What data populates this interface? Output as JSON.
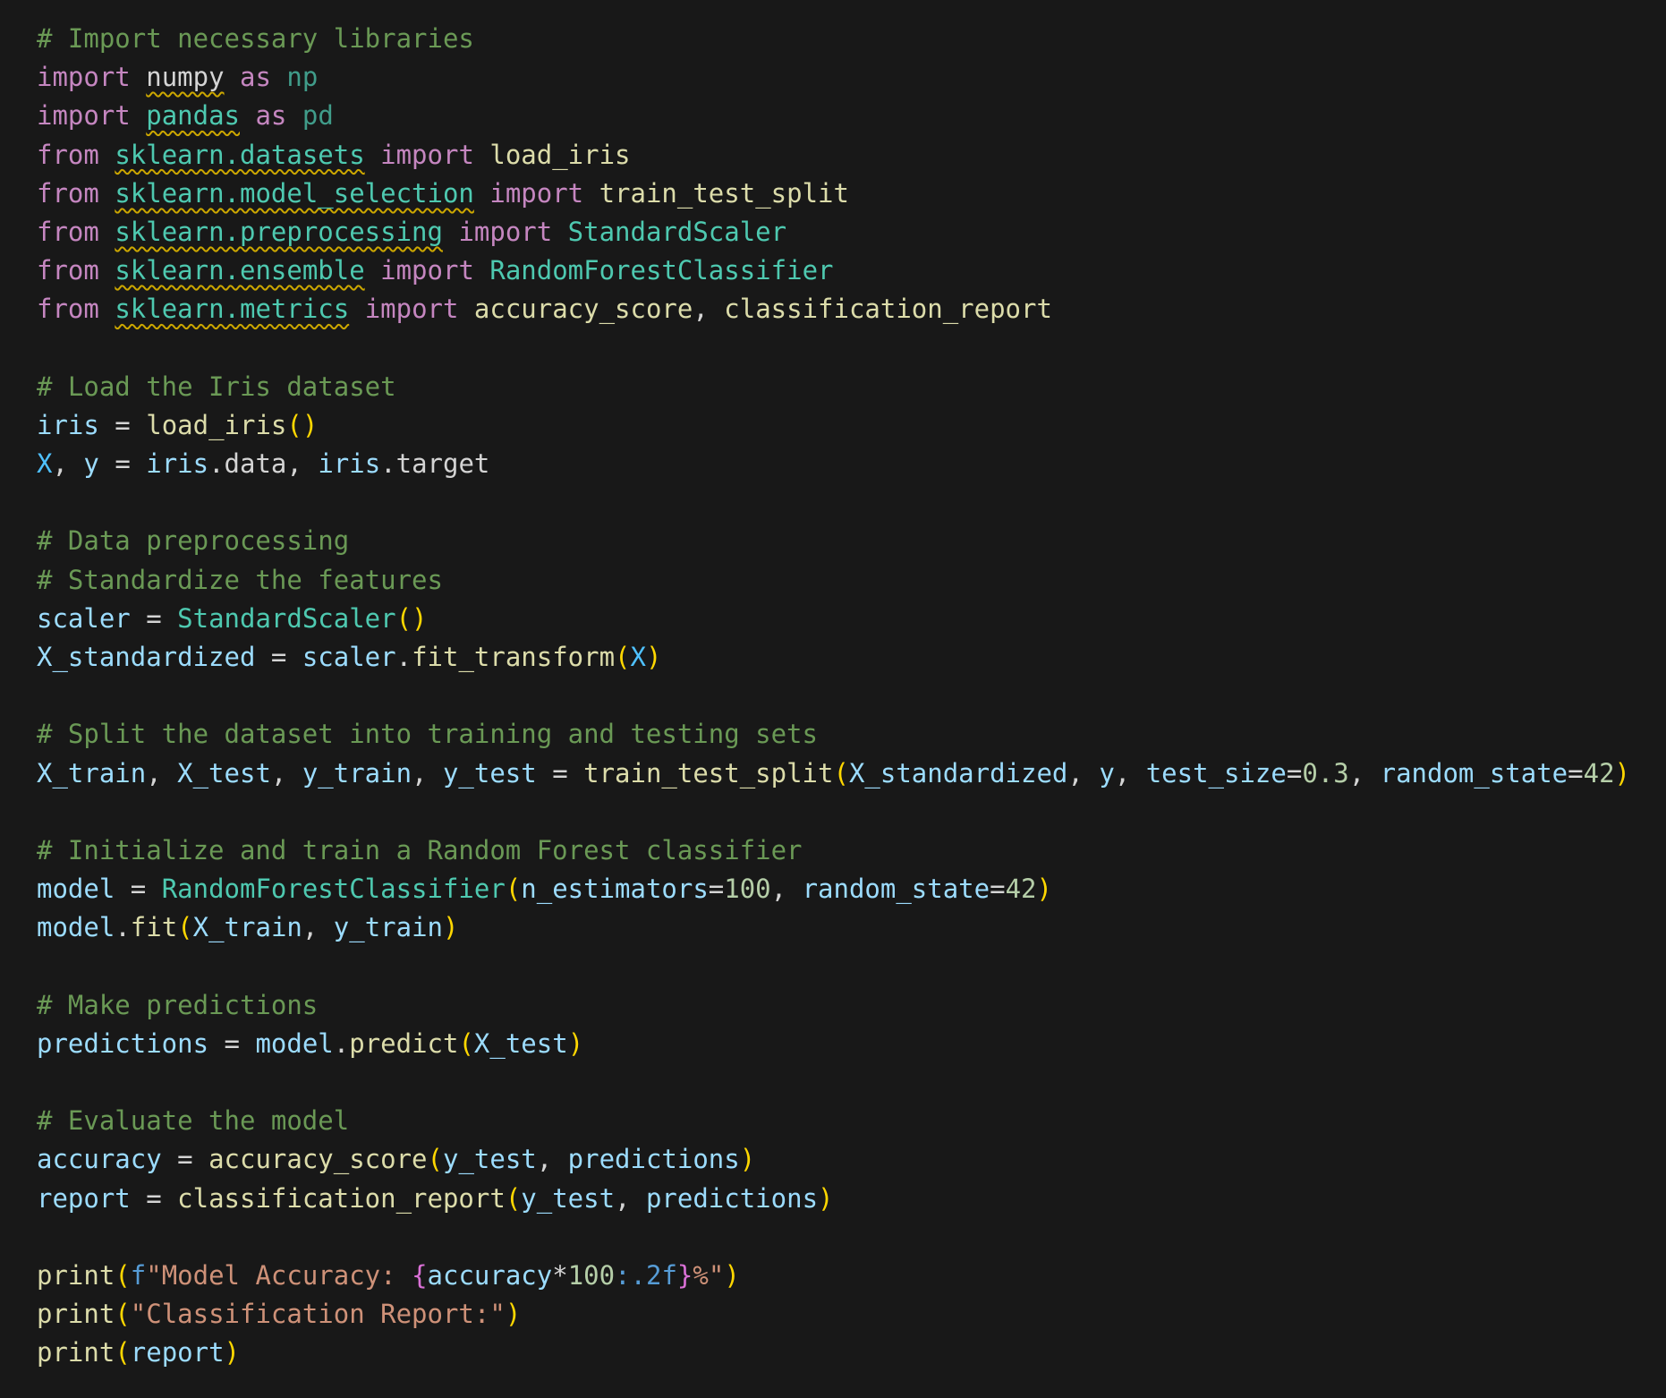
{
  "editor": {
    "colors": {
      "background": "#181818",
      "comment": "#6a9955",
      "keyword": "#c586c0",
      "class": "#4ec9b0",
      "function": "#dcdcaa",
      "variable": "#9cdcfe",
      "constant": "#4fc1ff",
      "number": "#b5cea8",
      "string": "#ce9178",
      "bracket": "#ffd700",
      "warning_squiggle": "#cca700"
    },
    "lines": [
      [
        {
          "t": "comment",
          "v": "# Import necessary libraries"
        }
      ],
      [
        {
          "t": "keyword",
          "v": "import"
        },
        {
          "t": "plain",
          "v": " "
        },
        {
          "t": "module",
          "v": "numpy",
          "sq": true
        },
        {
          "t": "plain",
          "v": " "
        },
        {
          "t": "keyword",
          "v": "as"
        },
        {
          "t": "plain",
          "v": " "
        },
        {
          "t": "alias",
          "v": "np"
        }
      ],
      [
        {
          "t": "keyword",
          "v": "import"
        },
        {
          "t": "plain",
          "v": " "
        },
        {
          "t": "module2",
          "v": "pandas",
          "sq": true
        },
        {
          "t": "plain",
          "v": " "
        },
        {
          "t": "keyword",
          "v": "as"
        },
        {
          "t": "plain",
          "v": " "
        },
        {
          "t": "alias",
          "v": "pd"
        }
      ],
      [
        {
          "t": "keyword",
          "v": "from"
        },
        {
          "t": "plain",
          "v": " "
        },
        {
          "t": "module2",
          "v": "sklearn.datasets",
          "sq": true
        },
        {
          "t": "plain",
          "v": " "
        },
        {
          "t": "keyword",
          "v": "import"
        },
        {
          "t": "plain",
          "v": " "
        },
        {
          "t": "func",
          "v": "load_iris"
        }
      ],
      [
        {
          "t": "keyword",
          "v": "from"
        },
        {
          "t": "plain",
          "v": " "
        },
        {
          "t": "module2",
          "v": "sklearn.model_selection",
          "sq": true
        },
        {
          "t": "plain",
          "v": " "
        },
        {
          "t": "keyword",
          "v": "import"
        },
        {
          "t": "plain",
          "v": " "
        },
        {
          "t": "func",
          "v": "train_test_split"
        }
      ],
      [
        {
          "t": "keyword",
          "v": "from"
        },
        {
          "t": "plain",
          "v": " "
        },
        {
          "t": "module2",
          "v": "sklearn.preprocessing",
          "sq": true
        },
        {
          "t": "plain",
          "v": " "
        },
        {
          "t": "keyword",
          "v": "import"
        },
        {
          "t": "plain",
          "v": " "
        },
        {
          "t": "class",
          "v": "StandardScaler"
        }
      ],
      [
        {
          "t": "keyword",
          "v": "from"
        },
        {
          "t": "plain",
          "v": " "
        },
        {
          "t": "module2",
          "v": "sklearn.ensemble",
          "sq": true
        },
        {
          "t": "plain",
          "v": " "
        },
        {
          "t": "keyword",
          "v": "import"
        },
        {
          "t": "plain",
          "v": " "
        },
        {
          "t": "class",
          "v": "RandomForestClassifier"
        }
      ],
      [
        {
          "t": "keyword",
          "v": "from"
        },
        {
          "t": "plain",
          "v": " "
        },
        {
          "t": "module2",
          "v": "sklearn.metrics",
          "sq": true
        },
        {
          "t": "plain",
          "v": " "
        },
        {
          "t": "keyword",
          "v": "import"
        },
        {
          "t": "plain",
          "v": " "
        },
        {
          "t": "func",
          "v": "accuracy_score"
        },
        {
          "t": "plain",
          "v": ", "
        },
        {
          "t": "func",
          "v": "classification_report"
        }
      ],
      [],
      [
        {
          "t": "comment",
          "v": "# Load the Iris dataset"
        }
      ],
      [
        {
          "t": "var",
          "v": "iris"
        },
        {
          "t": "op",
          "v": " = "
        },
        {
          "t": "func",
          "v": "load_iris"
        },
        {
          "t": "paren",
          "v": "()"
        }
      ],
      [
        {
          "t": "const",
          "v": "X"
        },
        {
          "t": "plain",
          "v": ", "
        },
        {
          "t": "var",
          "v": "y"
        },
        {
          "t": "op",
          "v": " = "
        },
        {
          "t": "var",
          "v": "iris"
        },
        {
          "t": "plain",
          "v": ".data, "
        },
        {
          "t": "var",
          "v": "iris"
        },
        {
          "t": "plain",
          "v": ".target"
        }
      ],
      [],
      [
        {
          "t": "comment",
          "v": "# Data preprocessing"
        }
      ],
      [
        {
          "t": "comment",
          "v": "# Standardize the features"
        }
      ],
      [
        {
          "t": "var",
          "v": "scaler"
        },
        {
          "t": "op",
          "v": " = "
        },
        {
          "t": "class",
          "v": "StandardScaler"
        },
        {
          "t": "paren",
          "v": "()"
        }
      ],
      [
        {
          "t": "var",
          "v": "X_standardized"
        },
        {
          "t": "op",
          "v": " = "
        },
        {
          "t": "var",
          "v": "scaler"
        },
        {
          "t": "plain",
          "v": "."
        },
        {
          "t": "func",
          "v": "fit_transform"
        },
        {
          "t": "paren",
          "v": "("
        },
        {
          "t": "const",
          "v": "X"
        },
        {
          "t": "paren",
          "v": ")"
        }
      ],
      [],
      [
        {
          "t": "comment",
          "v": "# Split the dataset into training and testing sets"
        }
      ],
      [
        {
          "t": "var",
          "v": "X_train"
        },
        {
          "t": "plain",
          "v": ", "
        },
        {
          "t": "var",
          "v": "X_test"
        },
        {
          "t": "plain",
          "v": ", "
        },
        {
          "t": "var",
          "v": "y_train"
        },
        {
          "t": "plain",
          "v": ", "
        },
        {
          "t": "var",
          "v": "y_test"
        },
        {
          "t": "op",
          "v": " = "
        },
        {
          "t": "func",
          "v": "train_test_split"
        },
        {
          "t": "paren",
          "v": "("
        },
        {
          "t": "var",
          "v": "X_standardized"
        },
        {
          "t": "plain",
          "v": ", "
        },
        {
          "t": "var",
          "v": "y"
        },
        {
          "t": "plain",
          "v": ", "
        },
        {
          "t": "var",
          "v": "test_size"
        },
        {
          "t": "op",
          "v": "="
        },
        {
          "t": "number",
          "v": "0.3"
        },
        {
          "t": "plain",
          "v": ", "
        },
        {
          "t": "var",
          "v": "random_state"
        },
        {
          "t": "op",
          "v": "="
        },
        {
          "t": "number",
          "v": "42"
        },
        {
          "t": "paren",
          "v": ")"
        }
      ],
      [],
      [
        {
          "t": "comment",
          "v": "# Initialize and train a Random Forest classifier"
        }
      ],
      [
        {
          "t": "var",
          "v": "model"
        },
        {
          "t": "op",
          "v": " = "
        },
        {
          "t": "class",
          "v": "RandomForestClassifier"
        },
        {
          "t": "paren",
          "v": "("
        },
        {
          "t": "var",
          "v": "n_estimators"
        },
        {
          "t": "op",
          "v": "="
        },
        {
          "t": "number",
          "v": "100"
        },
        {
          "t": "plain",
          "v": ", "
        },
        {
          "t": "var",
          "v": "random_state"
        },
        {
          "t": "op",
          "v": "="
        },
        {
          "t": "number",
          "v": "42"
        },
        {
          "t": "paren",
          "v": ")"
        }
      ],
      [
        {
          "t": "var",
          "v": "model"
        },
        {
          "t": "plain",
          "v": "."
        },
        {
          "t": "func",
          "v": "fit"
        },
        {
          "t": "paren",
          "v": "("
        },
        {
          "t": "var",
          "v": "X_train"
        },
        {
          "t": "plain",
          "v": ", "
        },
        {
          "t": "var",
          "v": "y_train"
        },
        {
          "t": "paren",
          "v": ")"
        }
      ],
      [],
      [
        {
          "t": "comment",
          "v": "# Make predictions"
        }
      ],
      [
        {
          "t": "var",
          "v": "predictions"
        },
        {
          "t": "op",
          "v": " = "
        },
        {
          "t": "var",
          "v": "model"
        },
        {
          "t": "plain",
          "v": "."
        },
        {
          "t": "func",
          "v": "predict"
        },
        {
          "t": "paren",
          "v": "("
        },
        {
          "t": "var",
          "v": "X_test"
        },
        {
          "t": "paren",
          "v": ")"
        }
      ],
      [],
      [
        {
          "t": "comment",
          "v": "# Evaluate the model"
        }
      ],
      [
        {
          "t": "var",
          "v": "accuracy"
        },
        {
          "t": "op",
          "v": " = "
        },
        {
          "t": "func",
          "v": "accuracy_score"
        },
        {
          "t": "paren",
          "v": "("
        },
        {
          "t": "var",
          "v": "y_test"
        },
        {
          "t": "plain",
          "v": ", "
        },
        {
          "t": "var",
          "v": "predictions"
        },
        {
          "t": "paren",
          "v": ")"
        }
      ],
      [
        {
          "t": "var",
          "v": "report"
        },
        {
          "t": "op",
          "v": " = "
        },
        {
          "t": "func",
          "v": "classification_report"
        },
        {
          "t": "paren",
          "v": "("
        },
        {
          "t": "var",
          "v": "y_test"
        },
        {
          "t": "plain",
          "v": ", "
        },
        {
          "t": "var",
          "v": "predictions"
        },
        {
          "t": "paren",
          "v": ")"
        }
      ],
      [],
      [
        {
          "t": "func",
          "v": "print"
        },
        {
          "t": "paren",
          "v": "("
        },
        {
          "t": "fprefix",
          "v": "f"
        },
        {
          "t": "string",
          "v": "\"Model Accuracy: "
        },
        {
          "t": "brace",
          "v": "{"
        },
        {
          "t": "var",
          "v": "accuracy"
        },
        {
          "t": "op",
          "v": "*"
        },
        {
          "t": "number",
          "v": "100"
        },
        {
          "t": "fmt",
          "v": ":.2f"
        },
        {
          "t": "brace",
          "v": "}"
        },
        {
          "t": "string",
          "v": "%\""
        },
        {
          "t": "paren",
          "v": ")"
        }
      ],
      [
        {
          "t": "func",
          "v": "print"
        },
        {
          "t": "paren",
          "v": "("
        },
        {
          "t": "string",
          "v": "\"Classification Report:\""
        },
        {
          "t": "paren",
          "v": ")"
        }
      ],
      [
        {
          "t": "func",
          "v": "print"
        },
        {
          "t": "paren",
          "v": "("
        },
        {
          "t": "var",
          "v": "report"
        },
        {
          "t": "paren",
          "v": ")"
        }
      ]
    ]
  }
}
